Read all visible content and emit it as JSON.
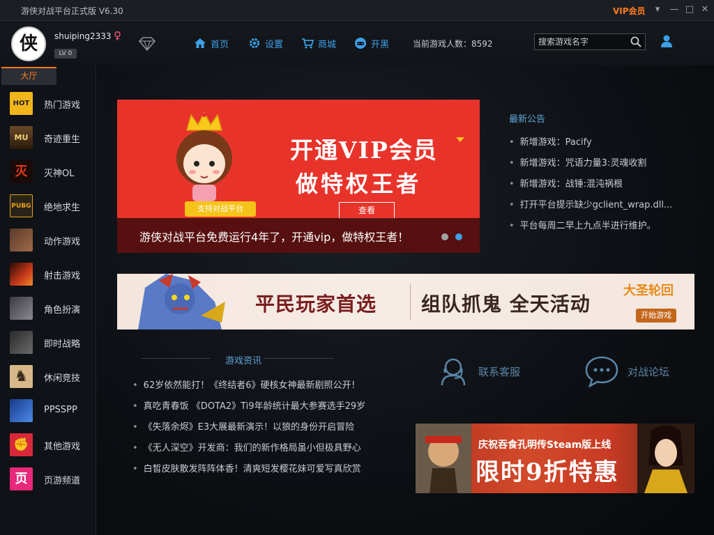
{
  "window": {
    "title": "游侠对战平台正式版 V6.30",
    "vip_label": "VIP会员",
    "controls": [
      "▾",
      "—",
      "□",
      "✕"
    ]
  },
  "user": {
    "avatar_glyph": "侠",
    "name": "shuiping2333",
    "gender": "♀",
    "level": "LV 0"
  },
  "nav": [
    {
      "label": "首页",
      "icon": "home-icon"
    },
    {
      "label": "设置",
      "icon": "gear-icon"
    },
    {
      "label": "商城",
      "icon": "cart-icon"
    },
    {
      "label": "开黑",
      "icon": "game-icon"
    }
  ],
  "online": "当前游戏人数：8592",
  "search": {
    "placeholder": "搜索游戏名字"
  },
  "sidebar": {
    "tab": "大厅",
    "items": [
      {
        "label": "热门游戏",
        "icon": "hot-icon",
        "glyph": "HOT"
      },
      {
        "label": "奇迹重生",
        "icon": "mu-icon",
        "glyph": "MU"
      },
      {
        "label": "灭神OL",
        "icon": "mieshen-icon",
        "glyph": "灭"
      },
      {
        "label": "绝地求生",
        "icon": "pubg-icon",
        "glyph": "PUBG"
      },
      {
        "label": "动作游戏",
        "icon": "action-icon",
        "glyph": ""
      },
      {
        "label": "射击游戏",
        "icon": "shooter-icon",
        "glyph": ""
      },
      {
        "label": "角色扮演",
        "icon": "rpg-icon",
        "glyph": ""
      },
      {
        "label": "即时战略",
        "icon": "rts-icon",
        "glyph": ""
      },
      {
        "label": "休闲竞技",
        "icon": "casual-icon",
        "glyph": "♞"
      },
      {
        "label": "PPSSPP",
        "icon": "ppsspp-icon",
        "glyph": ""
      },
      {
        "label": "其他游戏",
        "icon": "other-icon",
        "glyph": "✊"
      },
      {
        "label": "页游频道",
        "icon": "webgame-icon",
        "glyph": "页"
      }
    ]
  },
  "vip_banner": {
    "line1": "开通VIP会员",
    "line2": "做特权王者",
    "badge": "支持对战平台",
    "button": "查看",
    "caption": "游侠对战平台免费运行4年了，开通vip，做特权王者！"
  },
  "notices": {
    "title": "最新公告",
    "items": [
      "新增游戏：Pacify",
      "新增游戏：咒语力量3:灵魂收割",
      "新增游戏：战锤:混沌祸根",
      "打开平台提示缺少gclient_wrap.dll...",
      "平台每周二早上九点半进行维护。"
    ]
  },
  "wide_banner": {
    "left": "平民玩家首选",
    "right": "组队抓鬼 全天活动",
    "logo": "大圣轮回",
    "button": "开始游戏"
  },
  "news": {
    "title": "游戏资讯",
    "items": [
      "62岁依然能打！《终结者6》硬核女神最新剧照公开！",
      "真吃青春饭 《DOTA2》Ti9年龄统计最大参赛选手29岁",
      "《失落余烬》E3大展最新演示！以狼的身份开启冒险",
      "《无人深空》开发商：我们的新作格局虽小但极具野心",
      "白皙皮肤散发阵阵体香！清爽短发樱花妹可爱写真欣赏"
    ]
  },
  "links": {
    "service": "联系客服",
    "forum": "对战论坛"
  },
  "promo": {
    "line1": "庆祝吞食孔明传Steam版上线",
    "line2": "限时9折特惠"
  },
  "colors": {
    "accent_orange": "#ff7a1a",
    "link_blue": "#3da0e8",
    "banner_red": "#e8332b"
  }
}
